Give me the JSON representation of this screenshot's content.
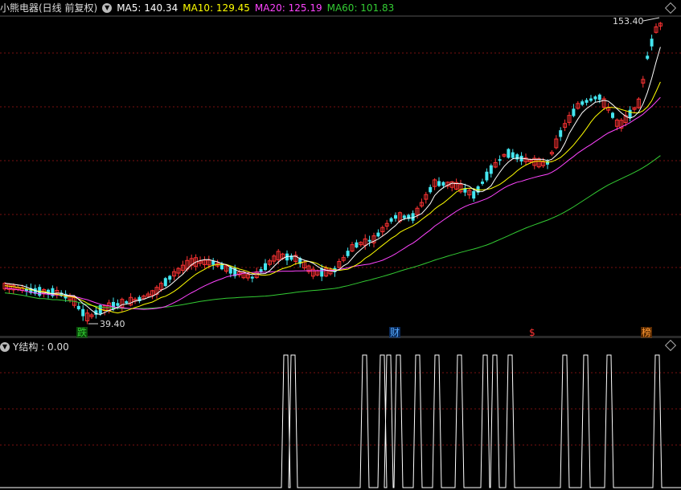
{
  "header": {
    "title": "小熊电器(日线 前复权)",
    "ma5_label": "MA5: 140.34",
    "ma10_label": "MA10: 129.45",
    "ma20_label": "MA20: 125.19",
    "ma60_label": "MA60: 101.83"
  },
  "colors": {
    "ma5": "#ffffff",
    "ma10": "#ffff00",
    "ma20": "#ff44ff",
    "ma60": "#33cc33",
    "up": "#ff3333",
    "down": "#44e6f0",
    "grid": "#7a1010",
    "indicator": "#ffffff"
  },
  "annotations": {
    "high_label": "153.40",
    "low_label": "39.40"
  },
  "markers": [
    {
      "text": "跌",
      "color": "#33cc33"
    },
    {
      "text": "财",
      "color": "#55aaff"
    },
    {
      "text": "$",
      "color": "#ff3333"
    },
    {
      "text": "榜",
      "color": "#ff9933"
    }
  ],
  "indicator": {
    "label": "Y结构 : 0.00"
  }
}
